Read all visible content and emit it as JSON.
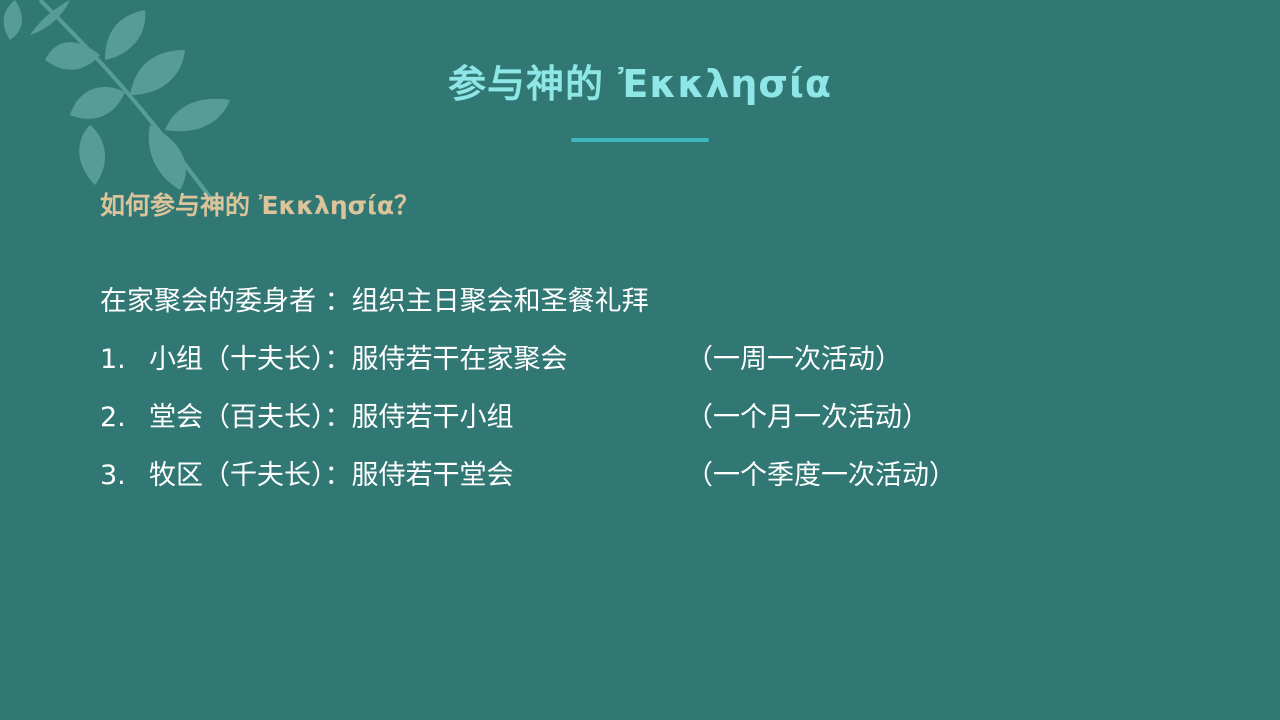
{
  "slide": {
    "title": "参与神的 Ἐκκλησία",
    "subtitle": "如何参与神的 Ἐκκλησία？",
    "intro": "在家聚会的委身者 ：组织主日聚会和圣餐礼拜",
    "items": [
      {
        "number": "1.",
        "text": "小组（十夫长）：服侍若干在家聚会",
        "note": "（一周一次活动）"
      },
      {
        "number": "2.",
        "text": "堂会（百夫长）：服侍若干小组",
        "note": "（一个月一次活动）"
      },
      {
        "number": "3.",
        "text": "牧区（千夫长）：服侍若干堂会",
        "note": "（一个季度一次活动）"
      }
    ]
  },
  "colors": {
    "background": "#317875",
    "title": "#8fe6e6",
    "accent_line": "#3fb7be",
    "subtitle": "#dcc49a",
    "body_text": "#ffffff"
  },
  "decoration": "leaf-branch"
}
